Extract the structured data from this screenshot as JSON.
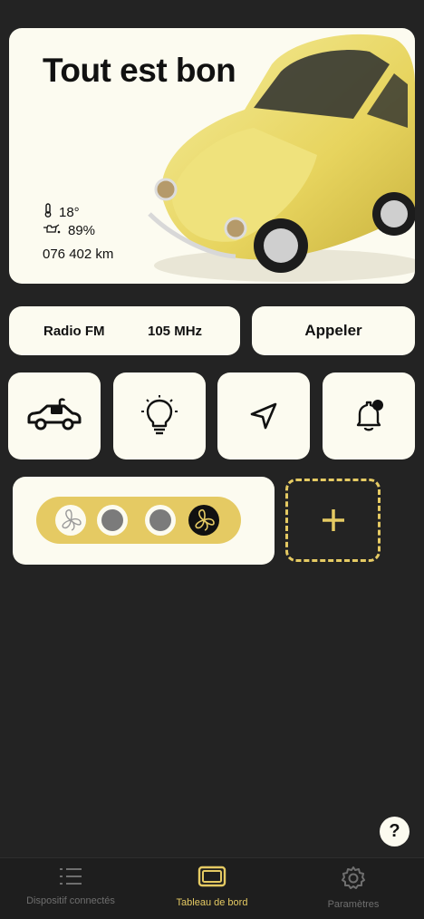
{
  "status": {
    "title": "Tout est bon",
    "temperature": "18°",
    "oil": "89%",
    "odometer": "076 402 km"
  },
  "radio": {
    "label": "Radio FM",
    "frequency": "105 MHz"
  },
  "call": {
    "label": "Appeler"
  },
  "quick_actions": [
    {
      "icon": "car-unlock-icon"
    },
    {
      "icon": "lightbulb-icon"
    },
    {
      "icon": "navigation-arrow-icon"
    },
    {
      "icon": "bell-notification-icon"
    }
  ],
  "fan": {
    "levels": 4,
    "selected_level": 4
  },
  "help": {
    "label": "?"
  },
  "tabs": [
    {
      "label": "Dispositif connectés",
      "icon": "list-icon",
      "active": false
    },
    {
      "label": "Tableau de bord",
      "icon": "dashboard-icon",
      "active": true
    },
    {
      "label": "Paramètres",
      "icon": "gear-icon",
      "active": false
    }
  ],
  "colors": {
    "background": "#232323",
    "card": "#fcfbf0",
    "accent": "#e5ca63",
    "inactive_tab": "#6f6f6f"
  }
}
